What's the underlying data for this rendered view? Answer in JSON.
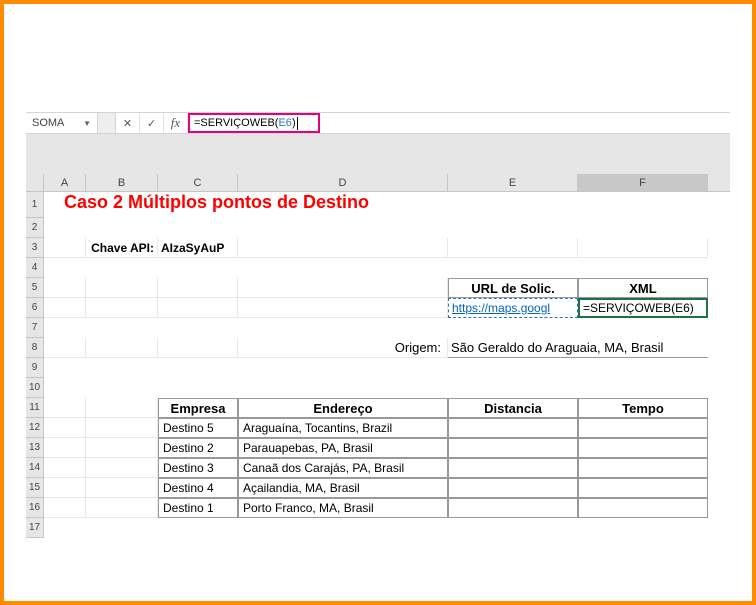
{
  "nameBox": "SOMA",
  "formula": {
    "prefix": "=SERVIÇOWEB(",
    "ref": "E6",
    "suffix": ")"
  },
  "columns": [
    "A",
    "B",
    "C",
    "D",
    "E",
    "F"
  ],
  "rowNumbers": [
    "1",
    "2",
    "3",
    "4",
    "5",
    "6",
    "7",
    "8",
    "9",
    "10",
    "11",
    "12",
    "13",
    "14",
    "15",
    "16",
    "17"
  ],
  "title": "Caso 2 Múltiplos pontos de Destino",
  "apiKeyLabel": "Chave API:",
  "apiKeyValue": "AIzaSyAuP",
  "headersRow5": {
    "E": "URL de Solic.",
    "F": "XML"
  },
  "row6": {
    "E": "https://maps.googl",
    "F": "=SERVIÇOWEB(E6)"
  },
  "row8": {
    "label": "Origem:",
    "value": "São Geraldo do Araguaia, MA, Brasil"
  },
  "tableHeaders": {
    "C": "Empresa",
    "D": "Endereço",
    "E": "Distancia",
    "F": "Tempo"
  },
  "tableRows": [
    {
      "empresa": "Destino 5",
      "endereco": "Araguaína, Tocantins, Brazil"
    },
    {
      "empresa": "Destino 2",
      "endereco": "Parauapebas, PA, Brasil"
    },
    {
      "empresa": "Destino 3",
      "endereco": "Canaã dos Carajás, PA, Brasil"
    },
    {
      "empresa": "Destino 4",
      "endereco": "Açailandia, MA, Brasil"
    },
    {
      "empresa": "Destino 1",
      "endereco": "Porto Franco, MA, Brasil"
    }
  ]
}
